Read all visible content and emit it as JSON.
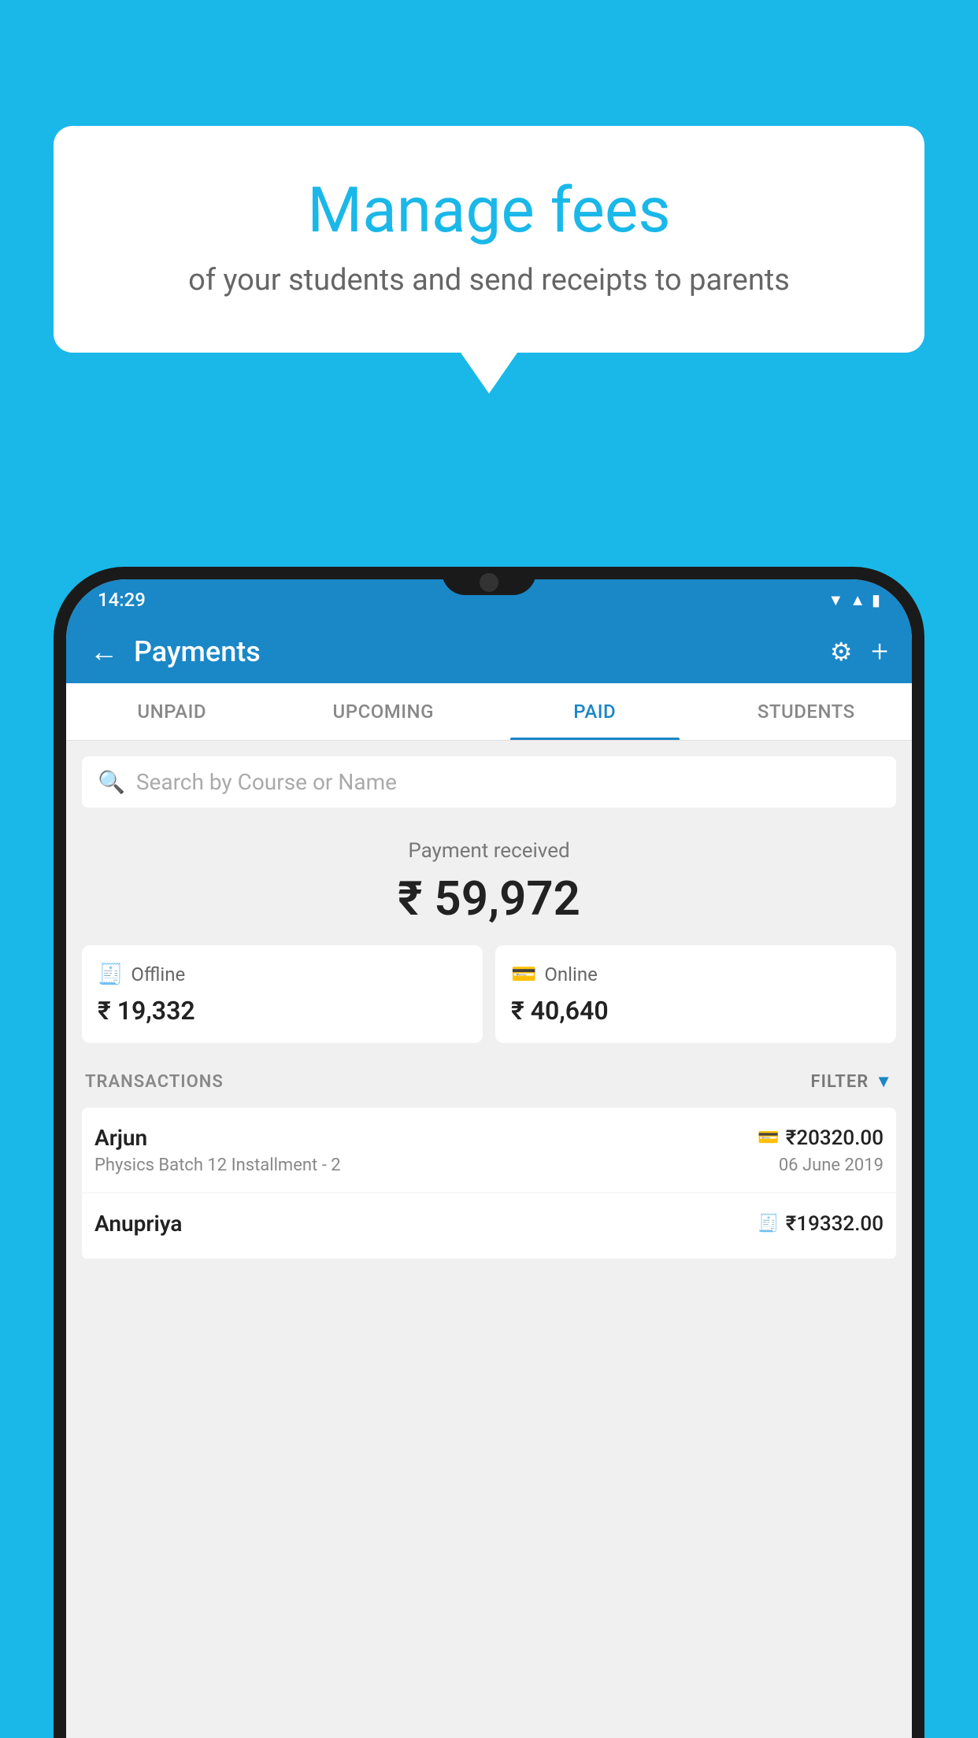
{
  "background_color": "#1ab8e8",
  "speech_bubble": {
    "title": "Manage fees",
    "subtitle": "of your students and send receipts to parents"
  },
  "status_bar": {
    "time": "14:29",
    "icons": [
      "wifi",
      "signal",
      "battery"
    ]
  },
  "app_bar": {
    "back_label": "←",
    "title": "Payments",
    "settings_icon": "gear-icon",
    "add_icon": "plus-icon"
  },
  "tabs": [
    {
      "label": "UNPAID",
      "active": false
    },
    {
      "label": "UPCOMING",
      "active": false
    },
    {
      "label": "PAID",
      "active": true
    },
    {
      "label": "STUDENTS",
      "active": false
    }
  ],
  "search": {
    "placeholder": "Search by Course or Name"
  },
  "payment_summary": {
    "label": "Payment received",
    "amount": "₹ 59,972",
    "offline": {
      "icon": "offline-payment-icon",
      "label": "Offline",
      "amount": "₹ 19,332"
    },
    "online": {
      "icon": "online-payment-icon",
      "label": "Online",
      "amount": "₹ 40,640"
    }
  },
  "transactions": {
    "section_label": "TRANSACTIONS",
    "filter_label": "FILTER",
    "items": [
      {
        "name": "Arjun",
        "payment_type": "online",
        "amount": "₹20320.00",
        "course": "Physics Batch 12 Installment - 2",
        "date": "06 June 2019"
      },
      {
        "name": "Anupriya",
        "payment_type": "offline",
        "amount": "₹19332.00",
        "course": "",
        "date": ""
      }
    ]
  }
}
